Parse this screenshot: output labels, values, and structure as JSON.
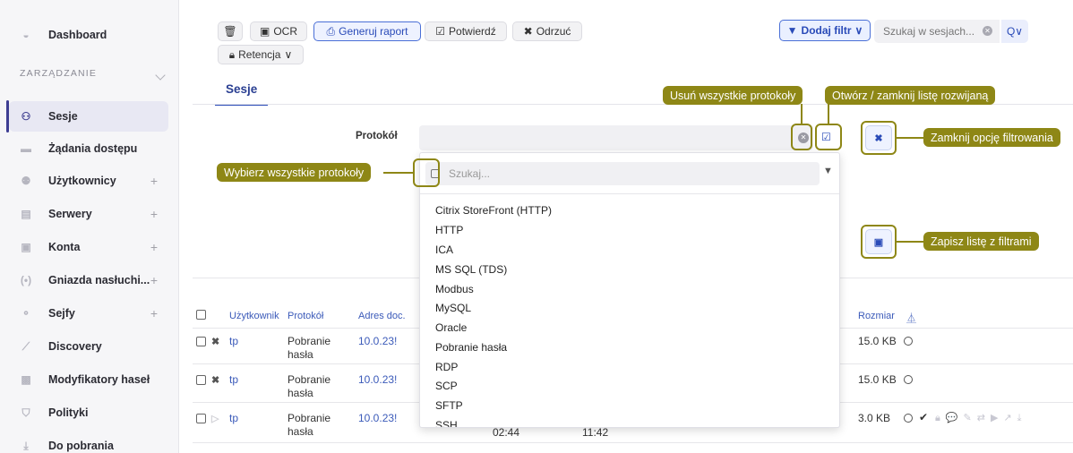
{
  "sidebar": {
    "section": "ZARZĄDZANIE",
    "items": [
      {
        "label": "Dashboard",
        "icon": "dashboard-icon",
        "plus": false
      },
      {
        "label": "Sesje",
        "icon": "sessions-icon",
        "plus": false,
        "active": true
      },
      {
        "label": "Żądania dostępu",
        "icon": "access-requests-icon",
        "plus": false
      },
      {
        "label": "Użytkownicy",
        "icon": "users-icon",
        "plus": true
      },
      {
        "label": "Serwery",
        "icon": "servers-icon",
        "plus": true
      },
      {
        "label": "Konta",
        "icon": "accounts-icon",
        "plus": true
      },
      {
        "label": "Gniazda nasłuchi...",
        "icon": "sockets-icon",
        "plus": true
      },
      {
        "label": "Sejfy",
        "icon": "safes-icon",
        "plus": true
      },
      {
        "label": "Discovery",
        "icon": "discovery-icon",
        "plus": false
      },
      {
        "label": "Modyfikatory haseł",
        "icon": "password-modifiers-icon",
        "plus": false
      },
      {
        "label": "Polityki",
        "icon": "policies-icon",
        "plus": false
      },
      {
        "label": "Do pobrania",
        "icon": "downloads-icon",
        "plus": false
      }
    ],
    "plus_symbol": "+"
  },
  "toolbar": {
    "delete_icon": "🗑",
    "ocr": "OCR",
    "report": "Generuj raport",
    "confirm": "Potwierdź",
    "reject": "Odrzuć",
    "retention": "Retencja",
    "add_filter": "Dodaj filtr",
    "search_placeholder": "Szukaj w sesjach...",
    "search_btn": "Q∨"
  },
  "tab": "Sesje",
  "filter": {
    "label": "Protokół",
    "search_placeholder": "Szukaj...",
    "options": [
      "Citrix StoreFront (HTTP)",
      "HTTP",
      "ICA",
      "MS SQL (TDS)",
      "Modbus",
      "MySQL",
      "Oracle",
      "Pobranie hasła",
      "RDP",
      "SCP",
      "SFTP",
      "SSH"
    ]
  },
  "callouts": {
    "remove_all": "Usuń wszystkie protokoły",
    "toggle_list": "Otwórz / zamknij listę rozwijaną",
    "close_filter": "Zamknij opcję filtrowania",
    "select_all": "Wybierz wszystkie protokoły",
    "save_list": "Zapisz listę z filtrami"
  },
  "table": {
    "headers": {
      "user": "Użytkownik",
      "protocol": "Protokół",
      "address": "Adres doc.",
      "size": "Rozmiar"
    },
    "rows": [
      {
        "user": "tp",
        "protocol": "Pobranie hasła",
        "address": "10.0.23!",
        "size": "15.0 KB",
        "mark": "✖"
      },
      {
        "user": "tp",
        "protocol": "Pobranie hasła",
        "address": "10.0.23!",
        "size": "15.0 KB",
        "mark": "✖"
      },
      {
        "user": "tp",
        "protocol": "Pobranie hasła",
        "address": "10.0.23!",
        "size": "3.0 KB",
        "mark": "▷",
        "t1": "02:44",
        "t2": "11:42"
      }
    ]
  }
}
